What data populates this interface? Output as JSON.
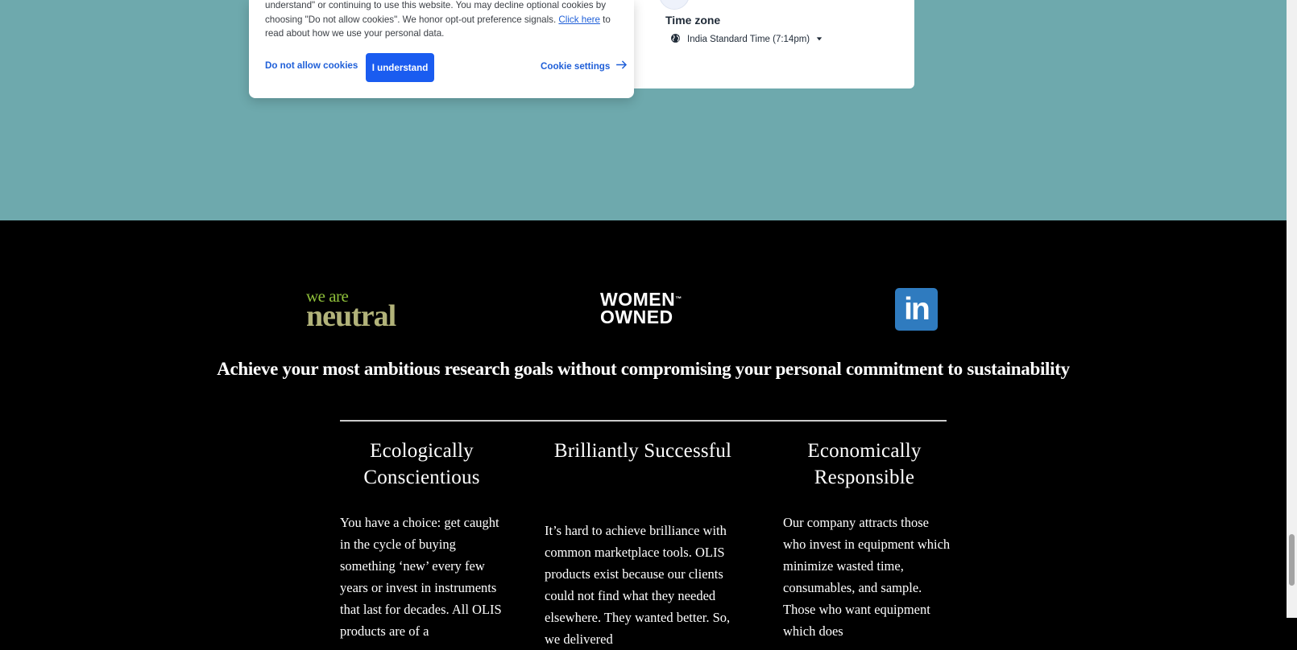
{
  "cookie_banner": {
    "text_part1": "understand\" or continuing to use this website. You may decline optional cookies by choosing \"Do not allow cookies\". We honor opt-out preference signals. ",
    "link_text": "Click here",
    "text_part2": " to read about how we use your personal data.",
    "decline_label": "Do not allow cookies",
    "accept_label": "I understand",
    "settings_label": "Cookie settings",
    "colors": {
      "button": "#1a5cf0",
      "link": "#1f5fd8"
    }
  },
  "scheduler": {
    "timezone_heading": "Time zone",
    "timezone_value": "India Standard Time (7:14pm)"
  },
  "footer": {
    "logos": {
      "neutral_top": "we are",
      "neutral_bottom": "neutral",
      "women_line1": "WOMEN",
      "women_line2": "OWNED",
      "linkedin": "in"
    },
    "tagline": "Achieve your most ambitious research goals without compromising your personal commitment to sustainability",
    "columns": [
      {
        "heading": "Ecologically Conscientious",
        "text": " You have a choice: get caught in the cycle of buying something ‘new’ every few years or invest in instruments that last for decades. All OLIS products are of a"
      },
      {
        "heading": "Brilliantly Successful",
        "text": "It’s hard to achieve brilliance with common marketplace tools. OLIS products exist because our clients could not find what they needed elsewhere. They wanted better. So, we delivered"
      },
      {
        "heading": "Economically Responsible",
        "text": "Our company attracts those who invest in equipment which minimize wasted time, consumables, and sample. Those who want equipment which does"
      }
    ]
  },
  "colors": {
    "teal_background": "#6ea9ad",
    "footer_background": "#000000",
    "linkedin_blue": "#2f7bbf"
  }
}
